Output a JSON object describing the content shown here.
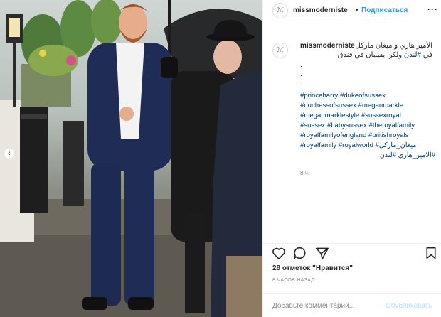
{
  "header": {
    "username": "missmoderniste",
    "separator": "•",
    "follow_label": "Подписаться",
    "more_label": "···"
  },
  "post": {
    "username": "missmoderniste",
    "caption_line1": "الأمير هاري و ميغان ماركل",
    "caption_line2_prefix": "في ",
    "caption_line2_tag": "#لندن",
    "caption_line2_rest": " ولكن يقيمان في فندق",
    "dot1": ".",
    "dot2": ".",
    "dot3": ".",
    "hashtags": [
      "#princeharry #dukeofsussex",
      "#duchessofsussex #meganmarkle",
      "#meganmarklestyle #sussexroyal",
      "#sussex #babysussex #theroyalfamily",
      "#royalfamilyofengland #britishroyals",
      "#royalfamily #royalworld #ميغان_ماركل",
      "#الامير_هاري #لندن"
    ],
    "time_ago": "8 ч."
  },
  "actions": {
    "icons": [
      "heart-icon",
      "comment-icon",
      "share-icon",
      "bookmark-icon"
    ]
  },
  "likes_label": "28 отметок \"Нравится\"",
  "posted_label": "8 ЧАСОВ НАЗАД",
  "add_comment": {
    "placeholder": "Добавьте комментарий...",
    "publish_label": "Опубликовать"
  },
  "colors": {
    "link": "#00376b",
    "follow": "#3897f0",
    "muted": "#8e8e8e",
    "publish_disabled": "#b2dffc"
  }
}
